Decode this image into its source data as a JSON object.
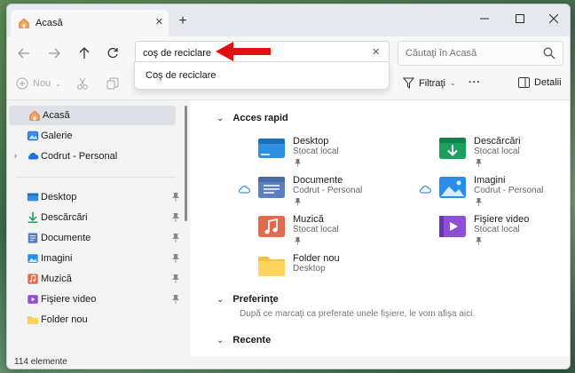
{
  "tab": {
    "title": "Acasă"
  },
  "address": {
    "value": "coş de reciclare"
  },
  "search": {
    "placeholder": "Căutaţi în Acasă"
  },
  "suggestion": {
    "label": "Coş de reciclare"
  },
  "commands": {
    "new_label": "Nou",
    "filter_label": "Filtraţi",
    "details_label": "Detalii"
  },
  "sidebar": {
    "top": [
      {
        "label": "Acasă"
      },
      {
        "label": "Galerie"
      },
      {
        "label": "Codrut - Personal"
      }
    ],
    "pinned": [
      {
        "label": "Desktop"
      },
      {
        "label": "Descărcări"
      },
      {
        "label": "Documente"
      },
      {
        "label": "Imagini"
      },
      {
        "label": "Muzică"
      },
      {
        "label": "Fişiere video"
      },
      {
        "label": "Folder nou"
      }
    ]
  },
  "main": {
    "quick_access_label": "Acces rapid",
    "items": [
      {
        "name": "Desktop",
        "sub": "Stocat local"
      },
      {
        "name": "Descărcări",
        "sub": "Stocat local"
      },
      {
        "name": "Documente",
        "sub": "Codrut - Personal"
      },
      {
        "name": "Imagini",
        "sub": "Codrut - Personal"
      },
      {
        "name": "Muzică",
        "sub": "Stocat local"
      },
      {
        "name": "Fişiere video",
        "sub": "Stocat local"
      },
      {
        "name": "Folder nou",
        "sub": "Desktop"
      }
    ],
    "favorites_label": "Preferinţe",
    "favorites_hint": "După ce marcaţi ca preferate unele fişiere, le vom afişa aici.",
    "recent_label": "Recente"
  },
  "status": {
    "count": "114 elemente"
  },
  "colors": {
    "accent": "#1b6fb8",
    "annotation_arrow": "#e01010"
  }
}
